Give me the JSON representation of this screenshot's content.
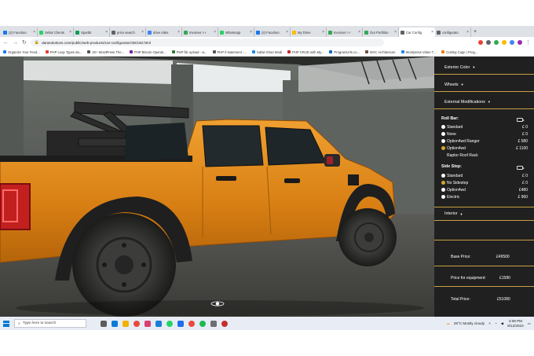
{
  "browser": {
    "tabs": [
      {
        "label": "(2) Faceboo",
        "color": "#1877f2"
      },
      {
        "label": "Sefair Clients",
        "color": "#25d366"
      },
      {
        "label": "Sparbit",
        "color": "#0f9d58"
      },
      {
        "label": "price search",
        "color": "#5f6368"
      },
      {
        "label": "drive rides",
        "color": "#4285f4"
      },
      {
        "label": "Invoices > r",
        "color": "#34a853"
      },
      {
        "label": "WhatsApp",
        "color": "#25d366"
      },
      {
        "label": "(2) Faceboo",
        "color": "#1877f2"
      },
      {
        "label": "My Drive",
        "color": "#fbbc04"
      },
      {
        "label": "Invoices > r",
        "color": "#34a853"
      },
      {
        "label": "Our Portfolio",
        "color": "#34a853"
      },
      {
        "label": "Car Config",
        "color": "#5f6368",
        "active": true
      },
      {
        "label": "configurato",
        "color": "#5f6368"
      }
    ],
    "url": "darasolutions.com/public/web-products/car-configurator/3D/150.html",
    "bookmarks": [
      "Organize Your Feed...",
      "PHP Loop Types da...",
      "20+ WordPress The...",
      "PHP Bitcoin Operati...",
      "PHP file upload - w...",
      "PHP if statement -...",
      "Safair Khan Modi",
      "PHP CRUD with My...",
      "Programiz/Is.co...",
      "MVC Architecture",
      "Wordpress Video T...",
      "Cutting Cage | Prog..."
    ]
  },
  "panel": {
    "exterior_color": "Exterior Color",
    "wheels": "Wheels",
    "external_mods": "External Modifications",
    "roll_bar": {
      "title": "Roll Bar:",
      "options": [
        {
          "name": "Standard",
          "price": "£ 0",
          "selected": false
        },
        {
          "name": "None",
          "price": "£ 0",
          "selected": false
        },
        {
          "name": "Option4wd Ranger",
          "price": "£ 580",
          "selected": false
        },
        {
          "name": "Option4wd",
          "price": "£ 1100",
          "selected": true
        }
      ],
      "sub_label": "Raptor Roof Rack"
    },
    "side_step": {
      "title": "Side Step:",
      "options": [
        {
          "name": "Standard",
          "price": "£ 0",
          "selected": false
        },
        {
          "name": "No Sidestep",
          "price": "£ 0",
          "selected": true
        },
        {
          "name": "Option4wd",
          "price": "£480",
          "selected": false
        },
        {
          "name": "Electric",
          "price": "£ 960",
          "selected": false
        }
      ]
    },
    "interior": "Interior",
    "summary": {
      "base_label": "Base Price:",
      "base_value": "£49500",
      "equip_label": "Price for equipment:",
      "equip_value": "£1580",
      "total_label": "Total Price:",
      "total_value": "£51080"
    }
  },
  "taskbar": {
    "search_placeholder": "Type here to search",
    "weather": "29°C  Mostly cloudy",
    "time": "3:08 PM",
    "date": "8/12/2023"
  }
}
